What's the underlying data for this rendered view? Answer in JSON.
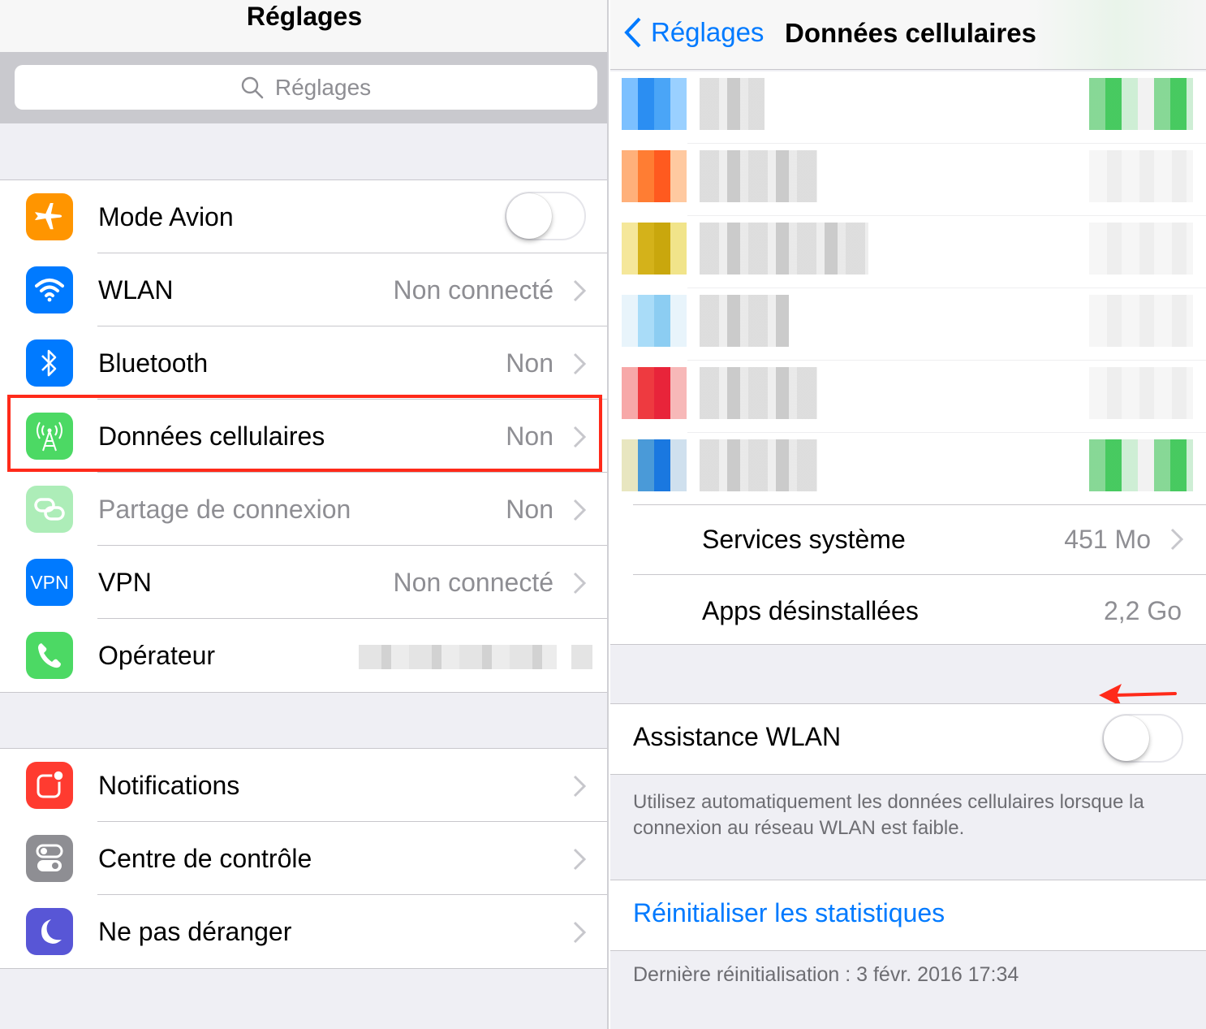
{
  "left": {
    "title": "Réglages",
    "search_placeholder": "Réglages",
    "group1": [
      {
        "label": "Mode Avion",
        "icon": "airplane-icon",
        "color": "#ff9500",
        "control": "toggle-off"
      },
      {
        "label": "WLAN",
        "value": "Non connecté",
        "icon": "wifi-icon",
        "color": "#007aff"
      },
      {
        "label": "Bluetooth",
        "value": "Non",
        "icon": "bluetooth-icon",
        "color": "#007aff"
      },
      {
        "label": "Données cellulaires",
        "value": "Non",
        "icon": "antenna-icon",
        "color": "#4cd964",
        "highlighted": true
      },
      {
        "label": "Partage de connexion",
        "value": "Non",
        "icon": "link-icon",
        "color": "#4cd964",
        "disabled": true
      },
      {
        "label": "VPN",
        "value": "Non connecté",
        "icon_text": "VPN",
        "color": "#007aff"
      },
      {
        "label": "Opérateur",
        "icon": "phone-icon",
        "color": "#4cd964"
      }
    ],
    "group2": [
      {
        "label": "Notifications",
        "icon": "notifications-icon",
        "color": "#ff3b30"
      },
      {
        "label": "Centre de contrôle",
        "icon": "switches-icon",
        "color": "#8e8e93"
      },
      {
        "label": "Ne pas déranger",
        "icon": "moon-icon",
        "color": "#5856d6"
      }
    ]
  },
  "right": {
    "back_label": "Réglages",
    "title": "Données cellulaires",
    "system_services": {
      "label": "Services système",
      "value": "451 Mo"
    },
    "uninstalled_apps": {
      "label": "Apps désinstallées",
      "value": "2,2 Go"
    },
    "wlan_assist": {
      "label": "Assistance WLAN",
      "state": "off"
    },
    "footnote": "Utilisez automatiquement les données cellulaires lorsque la connexion au réseau WLAN est faible.",
    "reset_label": "Réinitialiser les statistiques",
    "last_reset": "Dernière réinitialisation : 3 févr. 2016 17:34"
  },
  "colors": {
    "accent": "#007aff",
    "highlight": "#ff2a1a",
    "arrow": "#ff2a1a"
  }
}
